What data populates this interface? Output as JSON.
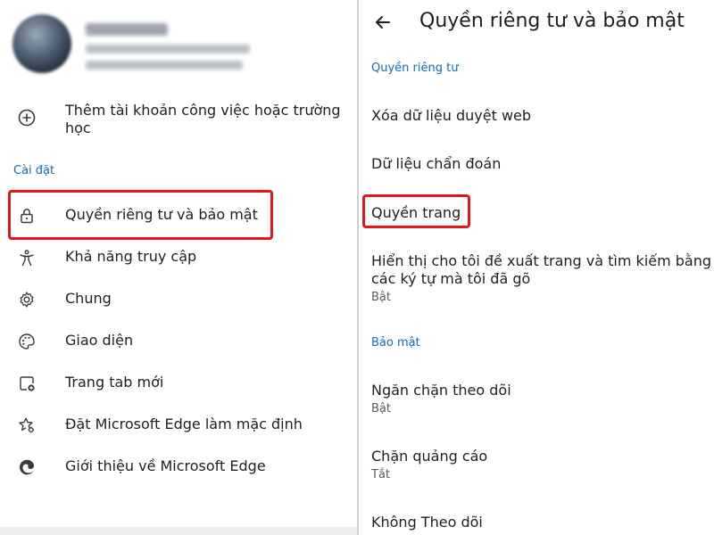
{
  "left": {
    "account": {
      "avatar": "blurred-profile-avatar"
    },
    "add_account_label_line1": "Thêm tài khoản công việc hoặc trường",
    "add_account_label_line2": "học",
    "settings_header": "Cài đặt",
    "menu": [
      {
        "label": "Quyền riêng tư và bảo mật",
        "icon": "lock-icon"
      },
      {
        "label": "Khả năng truy cập",
        "icon": "accessibility-icon"
      },
      {
        "label": "Chung",
        "icon": "gear-icon"
      },
      {
        "label": "Giao diện",
        "icon": "palette-icon"
      },
      {
        "label": "Trang tab mới",
        "icon": "new-tab-icon"
      },
      {
        "label": "Đặt Microsoft Edge làm mặc định",
        "icon": "star-settings-icon"
      },
      {
        "label": "Giới thiệu về Microsoft Edge",
        "icon": "edge-logo-icon"
      }
    ]
  },
  "right": {
    "title": "Quyền riêng tư và bảo mật",
    "privacy_header": "Quyền riêng tư",
    "items": {
      "clear_data": "Xóa dữ liệu duyệt web",
      "diagnostic": "Dữ liệu chẩn đoán",
      "site_permissions": "Quyền trang",
      "suggestions_line1": "Hiển thị cho tôi đề xuất trang và tìm kiếm bằng",
      "suggestions_line2": "các ký tự mà tôi đã gõ",
      "suggestions_status": "Bật"
    },
    "security_header": "Bảo mật",
    "security_items": {
      "tracking": "Ngăn chặn theo dõi",
      "tracking_status": "Bật",
      "ads": "Chặn quảng cáo",
      "ads_status": "Tắt",
      "dnt": "Không Theo dõi"
    }
  },
  "colors": {
    "accent": "#0f6cbd",
    "highlight": "#e3161c",
    "text": "#1f1f1f",
    "subtext": "#5b5b5b"
  }
}
